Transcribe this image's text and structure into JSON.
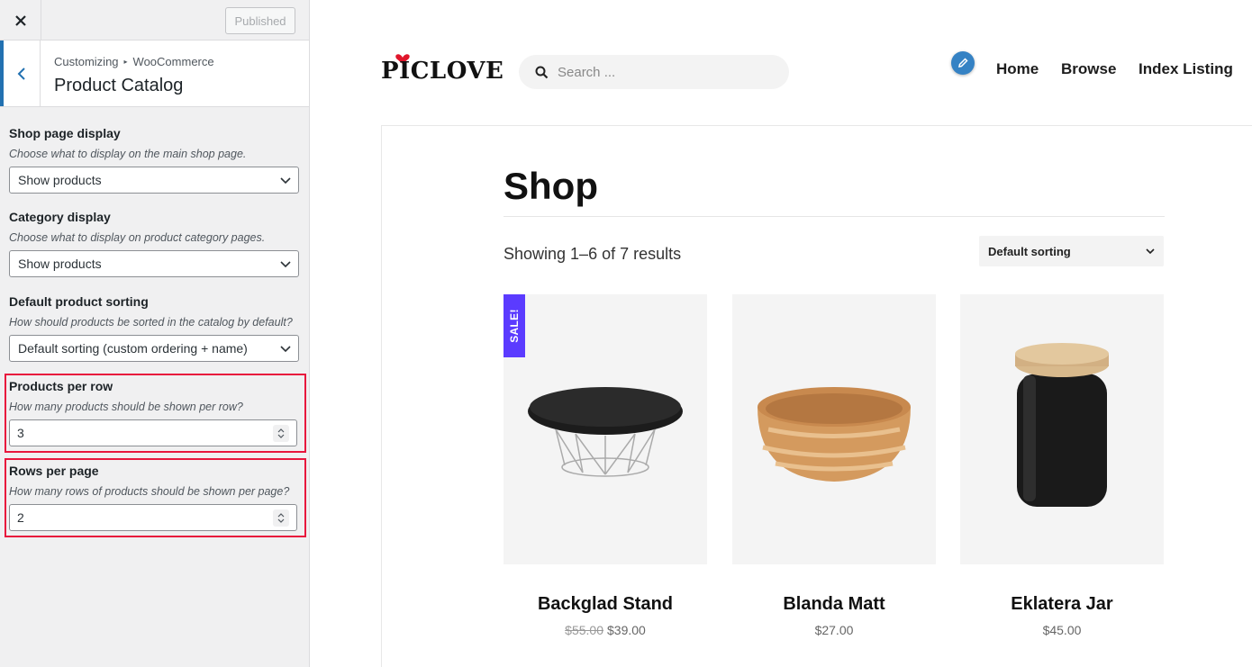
{
  "topbar": {
    "publish_label": "Published"
  },
  "section": {
    "breadcrumb_root": "Customizing",
    "breadcrumb_parent": "WooCommerce",
    "title": "Product Catalog"
  },
  "controls": {
    "shop_display": {
      "label": "Shop page display",
      "description": "Choose what to display on the main shop page.",
      "value": "Show products"
    },
    "category_display": {
      "label": "Category display",
      "description": "Choose what to display on product category pages.",
      "value": "Show products"
    },
    "default_sorting": {
      "label": "Default product sorting",
      "description": "How should products be sorted in the catalog by default?",
      "value": "Default sorting (custom ordering + name)"
    },
    "products_per_row": {
      "label": "Products per row",
      "description": "How many products should be shown per row?",
      "value": "3"
    },
    "rows_per_page": {
      "label": "Rows per page",
      "description": "How many rows of products should be shown per page?",
      "value": "2"
    }
  },
  "header": {
    "logo_text": "PICLOVE",
    "search_placeholder": "Search ...",
    "nav": [
      "Home",
      "Browse",
      "Index Listing"
    ]
  },
  "shop": {
    "title": "Shop",
    "result_count": "Showing 1–6 of 7 results",
    "sorting": "Default sorting",
    "products": [
      {
        "name": "Backglad Stand",
        "old_price": "$55.00",
        "price": "$39.00",
        "badge": "SALE!"
      },
      {
        "name": "Blanda Matt",
        "price": "$27.00"
      },
      {
        "name": "Eklatera Jar",
        "price": "$45.00"
      }
    ]
  },
  "colors": {
    "accent": "#2271b1",
    "highlight": "#e8173d",
    "sale_badge": "#5b3bff"
  }
}
